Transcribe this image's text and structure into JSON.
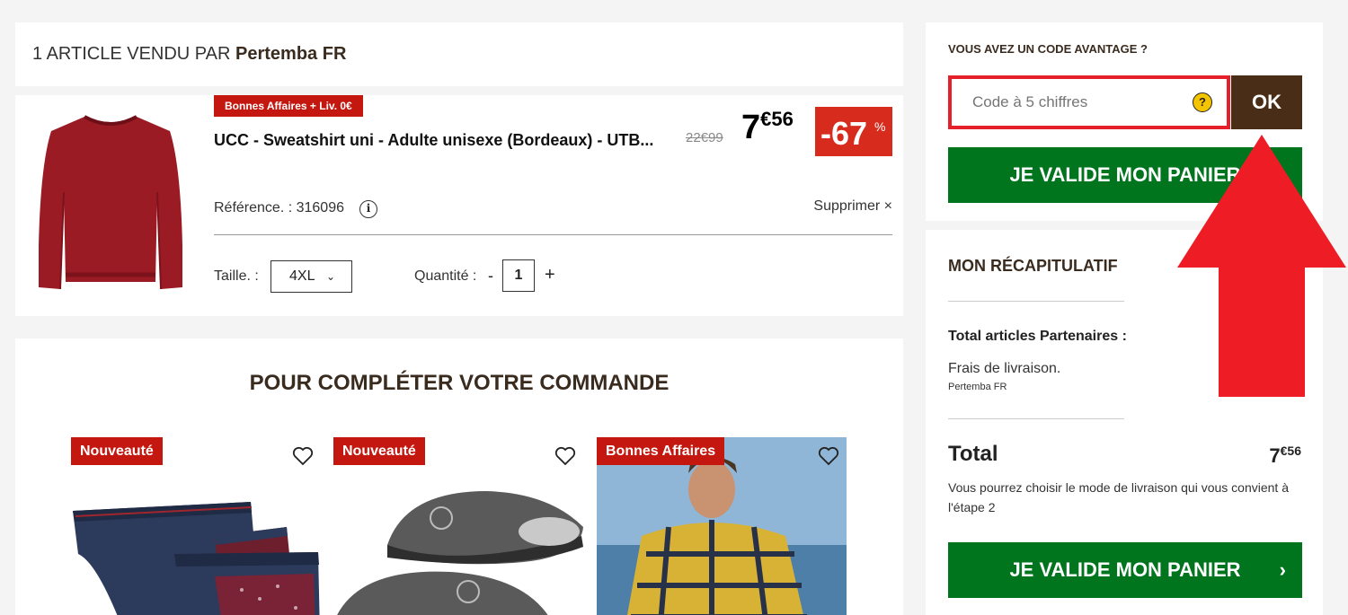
{
  "seller": {
    "prefix": "1 article vendu par",
    "name": "Pertemba FR"
  },
  "product": {
    "promo_tag": "Bonnes Affaires + Liv. 0€",
    "name": "UCC - Sweatshirt uni - Adulte unisexe (Bordeaux) - UTB...",
    "old_price": "22€99",
    "price_int": "7",
    "price_dec": "€56",
    "discount": "-67",
    "discount_sym": "%",
    "reference": "Référence. : 316096",
    "delete_label": "Supprimer ×",
    "size_label": "Taille. :",
    "size_value": "4XL",
    "qty_label": "Quantité :",
    "qty_minus": "-",
    "qty_value": "1",
    "qty_plus": "+",
    "image_color": "#9b1b24"
  },
  "suggestions": {
    "title": "POUR COMPLÉTER VOTRE COMMANDE",
    "items": [
      {
        "badge": "Nouveauté",
        "icon": "briefs"
      },
      {
        "badge": "Nouveauté",
        "icon": "slippers"
      },
      {
        "badge": "Bonnes Affaires",
        "icon": "plaid-shirt-man"
      }
    ]
  },
  "promo": {
    "title": "VOUS AVEZ UN CODE AVANTAGE ?",
    "placeholder": "Code à 5 chiffres",
    "help": "?",
    "ok_label": "OK",
    "validate_label": "JE VALIDE MON PANIER"
  },
  "summary": {
    "title": "MON RÉCAPITULATIF",
    "partners_label": "Total articles Partenaires :",
    "shipping_label": "Frais de livraison.",
    "shipping_seller": "Pertemba FR",
    "total_label": "Total",
    "total_int": "7",
    "total_dec": "€56",
    "note": "Vous pourrez choisir le mode de livraison qui vous convient à l'étape 2",
    "validate_label": "JE VALIDE MON PANIER",
    "validate_arrow": "›"
  },
  "colors": {
    "accent_red": "#c4170f",
    "brand_brown": "#4a2d16",
    "cta_green": "#00751e",
    "highlight_red": "#e5202a"
  }
}
